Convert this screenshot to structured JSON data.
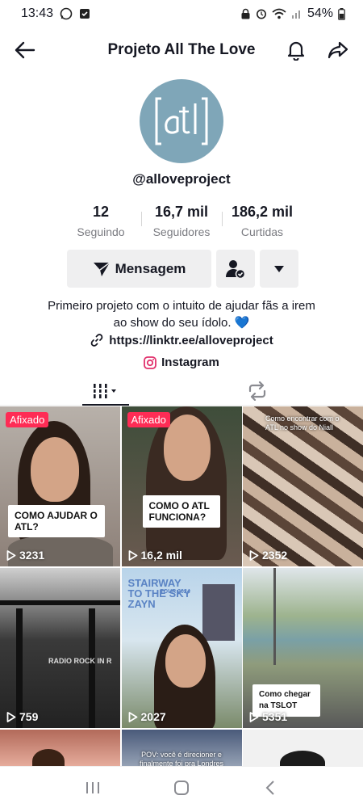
{
  "status": {
    "time": "13:43",
    "battery": "54%"
  },
  "header": {
    "title": "Projeto All The Love",
    "back_icon": "arrow-left-icon",
    "bell_icon": "bell-icon",
    "share_icon": "share-arrow-icon"
  },
  "profile": {
    "avatar_text": "pro ject",
    "username": "@alloveproject"
  },
  "stats": [
    {
      "value": "12",
      "label": "Seguindo"
    },
    {
      "value": "16,7 mil",
      "label": "Seguidores"
    },
    {
      "value": "186,2 mil",
      "label": "Curtidas"
    }
  ],
  "actions": {
    "message_label": "Mensagem"
  },
  "bio": {
    "line1": "Primeiro projeto com o intuito de ajudar fãs a irem",
    "line2": "ao show do seu ídolo. 💙",
    "link": "https://linktr.ee/alloveproject",
    "instagram": "Instagram"
  },
  "videos": [
    {
      "pinned": "Afixado",
      "views": "3231",
      "caption": "COMO AJUDAR O ATL?"
    },
    {
      "pinned": "Afixado",
      "views": "16,2 mil",
      "caption": "COMO O ATL FUNCIONA?"
    },
    {
      "views": "2352",
      "caption": "Como encontrar com o ATL no show do Niall"
    },
    {
      "views": "759",
      "caption": "RADIO ROCK IN R"
    },
    {
      "views": "2027",
      "caption": "STAIRWAY TO THE SKY ZAYN",
      "subcaption": "TOUR 2024"
    },
    {
      "views": "5351",
      "caption": "Como chegar na TSLOT"
    },
    {
      "caption": ""
    },
    {
      "caption": "POV: você é direcioner e finalmente foi pra Londres"
    },
    {
      "caption": ""
    }
  ],
  "colors": {
    "accent": "#fe2c55",
    "avatar_bg": "#7fa6b8",
    "button_bg": "#efeff0"
  }
}
